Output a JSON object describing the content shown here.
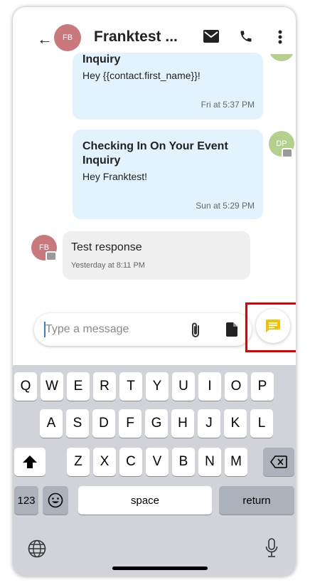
{
  "header": {
    "back_glyph": "←",
    "avatar_initials": "FB",
    "title": "Franktest ...",
    "icons": [
      "back-arrow-icon",
      "mail-icon",
      "phone-icon",
      "more-vertical-icon"
    ]
  },
  "messages": [
    {
      "title": "Inquiry",
      "body": "Hey {{contact.first_name}}!",
      "time": "Fri at 5:37 PM"
    },
    {
      "title": "Checking In On Your Event Inquiry",
      "body": "Hey Franktest!",
      "time": "Sun at 5:29 PM",
      "avatar": "DP"
    },
    {
      "body": "Test response",
      "time": "Yesterday at 8:11 PM",
      "avatar": "FB"
    }
  ],
  "composer": {
    "placeholder": "Type a message",
    "icons": [
      "paperclip-icon",
      "document-icon",
      "message-icon"
    ]
  },
  "keyboard": {
    "row1": [
      "Q",
      "W",
      "E",
      "R",
      "T",
      "Y",
      "U",
      "I",
      "O",
      "P"
    ],
    "row2": [
      "A",
      "S",
      "D",
      "F",
      "G",
      "H",
      "J",
      "K",
      "L"
    ],
    "row3": [
      "Z",
      "X",
      "C",
      "V",
      "B",
      "N",
      "M"
    ],
    "numbers_label": "123",
    "space_label": "space",
    "return_label": "return",
    "icons": [
      "shift-icon",
      "backspace-icon",
      "emoji-icon",
      "globe-icon",
      "microphone-icon"
    ]
  },
  "colors": {
    "bubble_blue": "#e3f3fd",
    "bubble_grey": "#efefef",
    "send_icon": "#f2c200",
    "highlight": "#e00000",
    "avatar_fb": "#c9787c",
    "avatar_dp": "#b5cf8d"
  }
}
